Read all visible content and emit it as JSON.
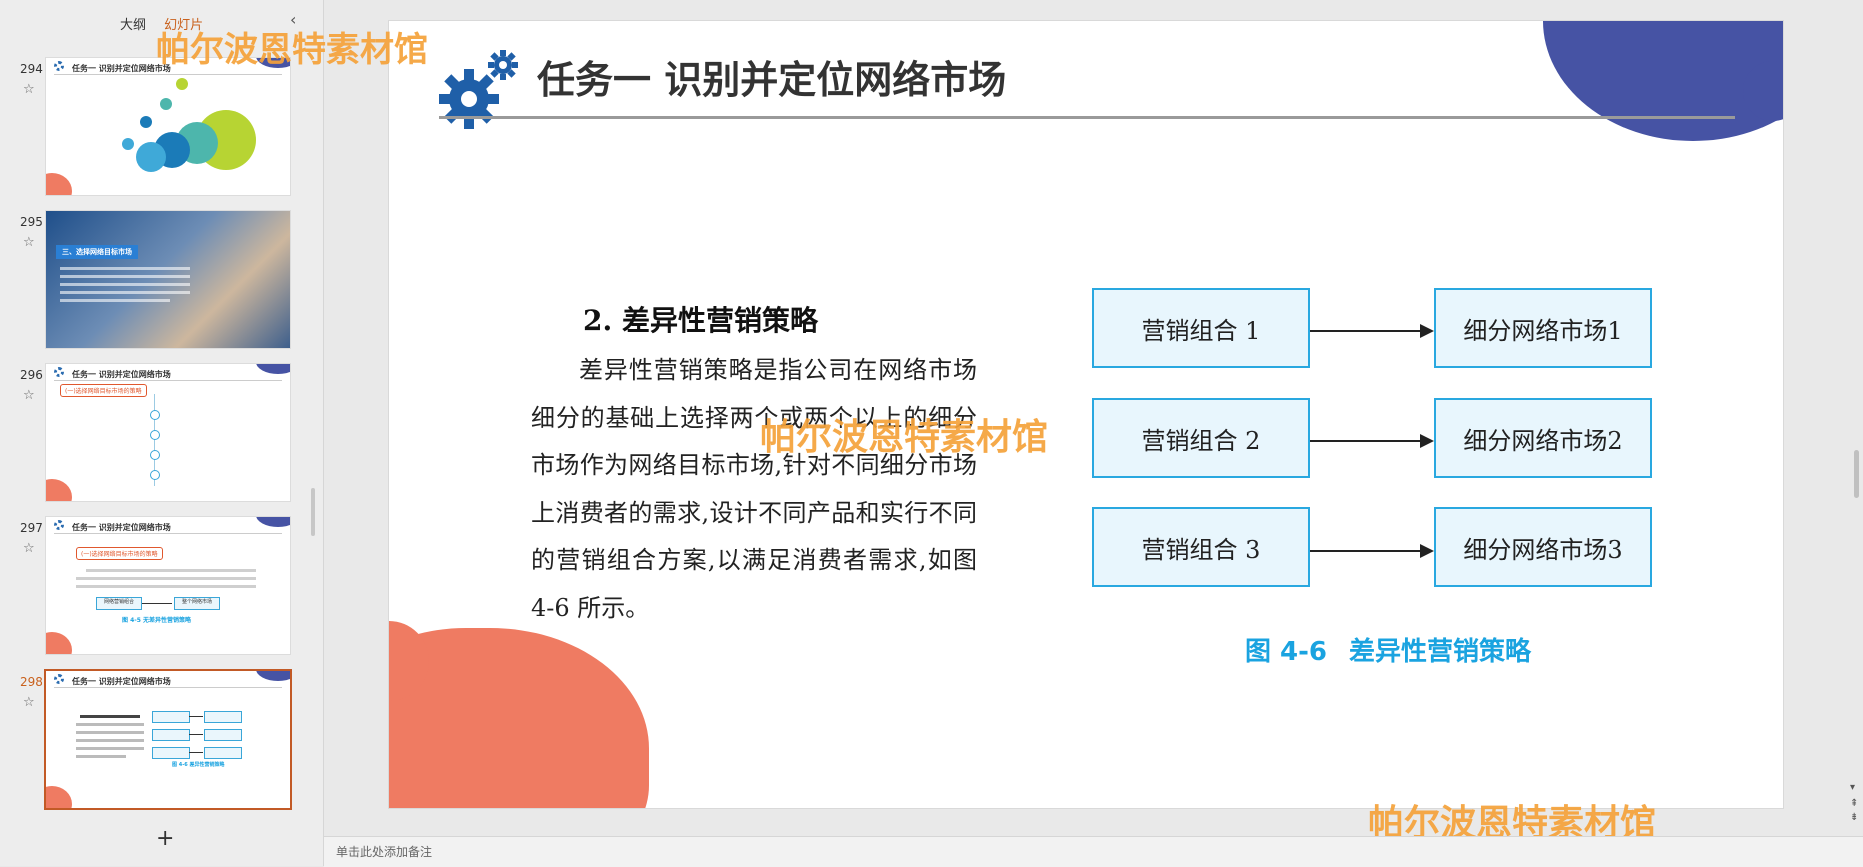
{
  "panel": {
    "tab_outline": "大纲",
    "tab_slides": "幻灯片",
    "add_label": "+"
  },
  "thumbnails": [
    {
      "number": "294",
      "title": "任务一 识别并定位网络市场"
    },
    {
      "number": "295",
      "title": "三、选择网络目标市场"
    },
    {
      "number": "296",
      "title": "任务一 识别并定位网络市场",
      "tag": "(一)选择网络目标市场的策略"
    },
    {
      "number": "297",
      "title": "任务一 识别并定位网络市场",
      "tag": "(一)选择网络目标市场的策略",
      "box1": "网络营销组合",
      "box2": "整个网络市场",
      "caption": "图 4-5   无差异性营销策略"
    },
    {
      "number": "298",
      "title": "任务一 识别并定位网络市场",
      "caption": "图 4-6   差异性营销策略"
    }
  ],
  "slide": {
    "title": "任务一 识别并定位网络市场",
    "heading": "2. 差异性营销策略",
    "body": "差异性营销策略是指公司在网络市场细分的基础上选择两个或两个以上的细分市场作为网络目标市场,针对不同细分市场上消费者的需求,设计不同产品和实行不同的营销组合方案,以满足消费者需求,如图 4-6 所示。",
    "left_boxes": [
      "营销组合 1",
      "营销组合 2",
      "营销组合 3"
    ],
    "right_boxes": [
      "细分网络市场1",
      "细分网络市场2",
      "细分网络市场3"
    ],
    "caption_number": "图 4-6",
    "caption_text": "差异性营销策略"
  },
  "watermark": "帕尔波恩特素材馆",
  "notes_placeholder": "单击此处添加备注",
  "colors": {
    "accent_orange": "#c9611d",
    "blob_blue": "#4653a4",
    "blob_coral": "#ef7b62",
    "box_border": "#29a8e0",
    "caption_blue": "#1aa3e0"
  }
}
